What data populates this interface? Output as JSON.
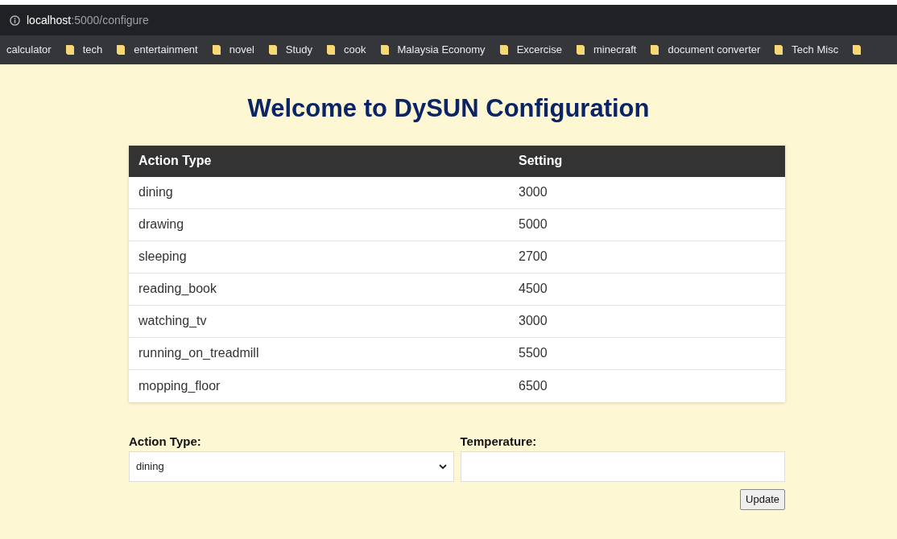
{
  "address_bar": {
    "host": "localhost",
    "path": ":5000/configure"
  },
  "bookmarks": [
    {
      "label": "calculator",
      "kind": "page"
    },
    {
      "label": "tech",
      "kind": "folder"
    },
    {
      "label": "entertainment",
      "kind": "folder"
    },
    {
      "label": "novel",
      "kind": "folder"
    },
    {
      "label": "Study",
      "kind": "folder"
    },
    {
      "label": "cook",
      "kind": "folder"
    },
    {
      "label": "Malaysia Economy",
      "kind": "folder"
    },
    {
      "label": "Excercise",
      "kind": "folder"
    },
    {
      "label": "minecraft",
      "kind": "folder"
    },
    {
      "label": "document converter",
      "kind": "folder"
    },
    {
      "label": "Tech Misc",
      "kind": "folder"
    }
  ],
  "heading": "Welcome to DySUN Configuration",
  "table": {
    "columns": [
      "Action Type",
      "Setting"
    ],
    "rows": [
      [
        "dining",
        "3000"
      ],
      [
        "drawing",
        "5000"
      ],
      [
        "sleeping",
        "2700"
      ],
      [
        "reading_book",
        "4500"
      ],
      [
        "watching_tv",
        "3000"
      ],
      [
        "running_on_treadmill",
        "5500"
      ],
      [
        "mopping_floor",
        "6500"
      ]
    ]
  },
  "form": {
    "action_label": "Action Type:",
    "action_value": "dining",
    "temperature_label": "Temperature:",
    "button": "Update"
  }
}
